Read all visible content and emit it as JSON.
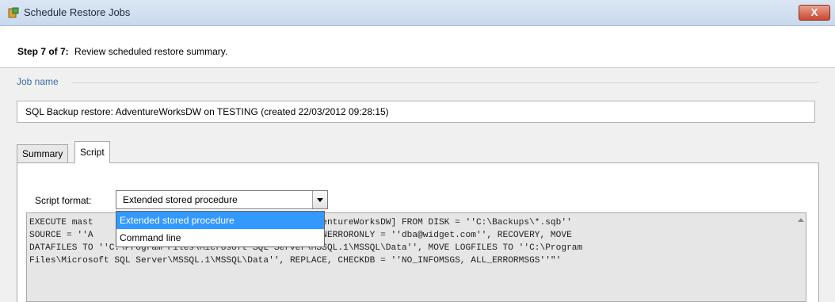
{
  "window": {
    "title": "Schedule Restore Jobs",
    "close_label": "X",
    "icon": "restore-app-icon"
  },
  "step": {
    "label": "Step 7 of 7:",
    "description": "Review scheduled restore summary."
  },
  "job_name": {
    "group_label": "Job name",
    "value": "SQL Backup restore: AdventureWorksDW on TESTING (created 22/03/2012 09:28:15)"
  },
  "tabs": [
    {
      "label": "Summary",
      "active": false
    },
    {
      "label": "Script",
      "active": true
    }
  ],
  "script_format": {
    "label": "Script format:",
    "selected": "Extended stored procedure",
    "options": [
      "Extended stored procedure",
      "Command line"
    ]
  },
  "script": {
    "text": "EXECUTE mast                              DATABASE [AdventureWorksDW] FROM DISK = ''C:\\Backups\\*.sqb''\nSOURCE = ''A                              WITH MAILTO_ONERRORONLY = ''dba@widget.com'', RECOVERY, MOVE\nDATAFILES TO ''C:\\Program Files\\Microsoft SQL Server\\MSSQL.1\\MSSQL\\Data'', MOVE LOGFILES TO ''C:\\Program\nFiles\\Microsoft SQL Server\\MSSQL.1\\MSSQL\\Data'', REPLACE, CHECKDB = ''NO_INFOMSGS, ALL_ERRORMSGS''\"'"
  },
  "colors": {
    "selection": "#3399ff",
    "group_label": "#3a6ea5",
    "close_button": "#c9492f"
  }
}
